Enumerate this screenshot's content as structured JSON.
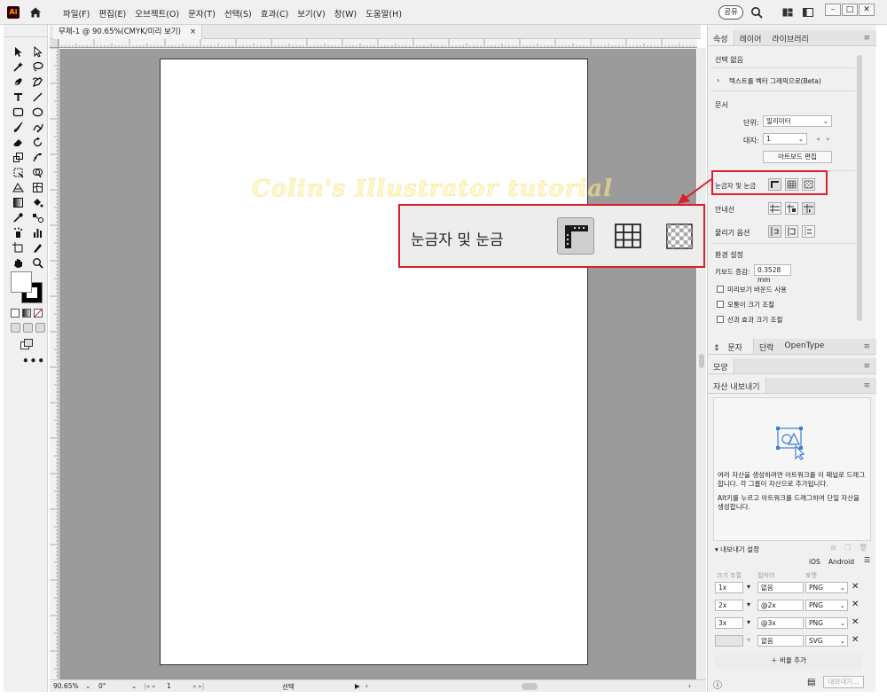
{
  "app": {
    "logo": "Ai",
    "menu": [
      "파일(F)",
      "편집(E)",
      "오브젝트(O)",
      "문자(T)",
      "선택(S)",
      "효과(C)",
      "보기(V)",
      "창(W)",
      "도움말(H)"
    ],
    "share": "공유"
  },
  "document": {
    "tab_title": "무제-1 @ 90.65%(CMYK/미리 보기)",
    "tab_close": "×"
  },
  "watermark": "Colin's Illustrator tutorial",
  "status": {
    "zoom": "90.65%",
    "rotation": "0°",
    "artboard": "1",
    "mode": "선택"
  },
  "properties_panel": {
    "tabs": [
      "속성",
      "레이어",
      "라이브러리"
    ],
    "no_selection": "선택 없음",
    "vectorize": "텍스트를 벡터 그래픽으로(Beta)",
    "document_section": "문서",
    "units_label": "단위:",
    "units_value": "밀리미터",
    "artboard_label": "대지:",
    "artboard_value": "1",
    "artboard_edit": "아트보드 편집",
    "rulers_grids": "눈금자 및 눈금",
    "guides": "안내선",
    "snap_options": "물리기 옵션",
    "preferences": "환경 설정",
    "keyboard_increment_label": "키보드 증감:",
    "keyboard_increment_value": "0.3528 mm",
    "preview_bounds": "미리보기 바운드 사용",
    "scale_corners": "모퉁이 크기 조절",
    "scale_strokes": "선과 효과 크기 조절"
  },
  "char_panel": {
    "tabs": [
      "문자",
      "단락",
      "OpenType"
    ]
  },
  "shape_panel": {
    "title": "모양"
  },
  "asset_export": {
    "title": "자산 내보내기",
    "hint1": "여러 자산을 생성하려면 아트워크를 이 패널로 드래그합니다. 각 그룹이 자산으로 추가됩니다.",
    "hint2": "Alt키를 누르고 아트워크를 드래그하여 단일 자산을 생성합니다.",
    "export_settings": "내보내기 설정",
    "ios": "iOS",
    "android": "Android",
    "col_scale": "크기 조절",
    "col_suffix": "접미어",
    "col_format": "포맷",
    "rows": [
      {
        "scale": "1x",
        "suffix": "없음",
        "format": "PNG"
      },
      {
        "scale": "2x",
        "suffix": "@2x",
        "format": "PNG"
      },
      {
        "scale": "3x",
        "suffix": "@3x",
        "format": "PNG"
      },
      {
        "scale": "",
        "suffix": "없음",
        "format": "SVG"
      }
    ],
    "add_scale": "비율 추가",
    "export_button": "내보내기..."
  },
  "callout": {
    "label": "눈금자 및 눈금"
  },
  "colors": {
    "highlight": "#d9202a",
    "canvas": "#9b9b9b",
    "panel": "#f0f0f0",
    "export_icon": "#3b7fd4"
  }
}
